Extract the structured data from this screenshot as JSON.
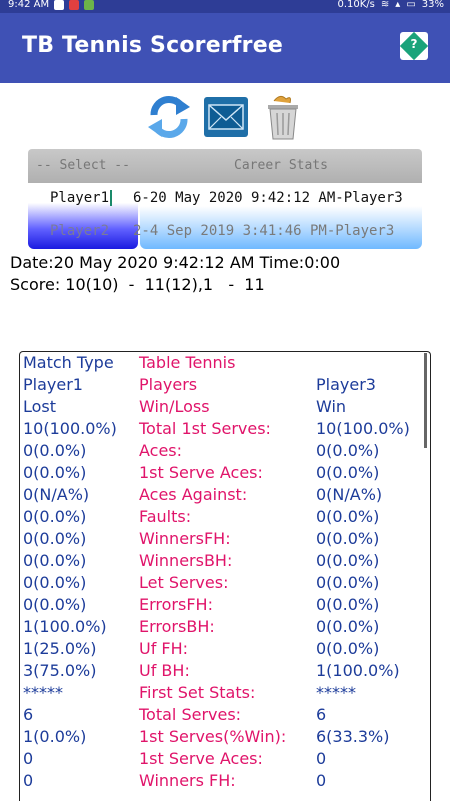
{
  "status_bar": {
    "time": "9:42 AM",
    "net_speed": "0.10K/s",
    "battery": "33%"
  },
  "app_bar": {
    "title": "TB Tennis Scorerfree",
    "help_icon": "help-diamond-icon"
  },
  "toolbar": {
    "icons": [
      "refresh-icon",
      "mail-icon",
      "trash-icon"
    ]
  },
  "picker": {
    "select_header": "-- Select --",
    "career_header": "Career Stats",
    "players": [
      "Player1",
      "Player2"
    ],
    "matches": [
      "6-20 May 2020 9:42:12 AM-Player3",
      "2-4 Sep 2019 3:41:46 PM-Player3"
    ]
  },
  "match_info": {
    "date_line": "Date:20 May 2020 9:42:12 AM Time:0:00",
    "score_line": "Score: 10(10)  -  11(12),1   -  11"
  },
  "stats": {
    "rows": [
      {
        "a": "Match Type",
        "b": "Table Tennis",
        "c": ""
      },
      {
        "a": "Player1",
        "b": "Players",
        "c": "Player3"
      },
      {
        "a": "Lost",
        "b": "Win/Loss",
        "c": "Win"
      },
      {
        "a": "10(100.0%)",
        "b": "Total 1st Serves:",
        "c": "10(100.0%)"
      },
      {
        "a": "0(0.0%)",
        "b": "Aces:",
        "c": "0(0.0%)"
      },
      {
        "a": "0(0.0%)",
        "b": "1st Serve Aces:",
        "c": "0(0.0%)"
      },
      {
        "a": "0(N/A%)",
        "b": "Aces Against:",
        "c": "0(N/A%)"
      },
      {
        "a": "0(0.0%)",
        "b": "Faults:",
        "c": "0(0.0%)"
      },
      {
        "a": "0(0.0%)",
        "b": "WinnersFH:",
        "c": "0(0.0%)"
      },
      {
        "a": "0(0.0%)",
        "b": "WinnersBH:",
        "c": "0(0.0%)"
      },
      {
        "a": "0(0.0%)",
        "b": "Let Serves:",
        "c": "0(0.0%)"
      },
      {
        "a": "0(0.0%)",
        "b": "ErrorsFH:",
        "c": "0(0.0%)"
      },
      {
        "a": "1(100.0%)",
        "b": "ErrorsBH:",
        "c": "0(0.0%)"
      },
      {
        "a": "1(25.0%)",
        "b": "Uf FH:",
        "c": "0(0.0%)"
      },
      {
        "a": "3(75.0%)",
        "b": "Uf BH:",
        "c": "1(100.0%)"
      },
      {
        "a": "*****",
        "b": "First Set Stats:",
        "c": "*****"
      },
      {
        "a": "6",
        "b": "Total Serves:",
        "c": "6"
      },
      {
        "a": "1(0.0%)",
        "b": "1st Serves(%Win):",
        "c": "6(33.3%)"
      },
      {
        "a": "0",
        "b": "1st Serve Aces:",
        "c": "0"
      },
      {
        "a": "0",
        "b": "Winners FH:",
        "c": "0"
      }
    ]
  }
}
